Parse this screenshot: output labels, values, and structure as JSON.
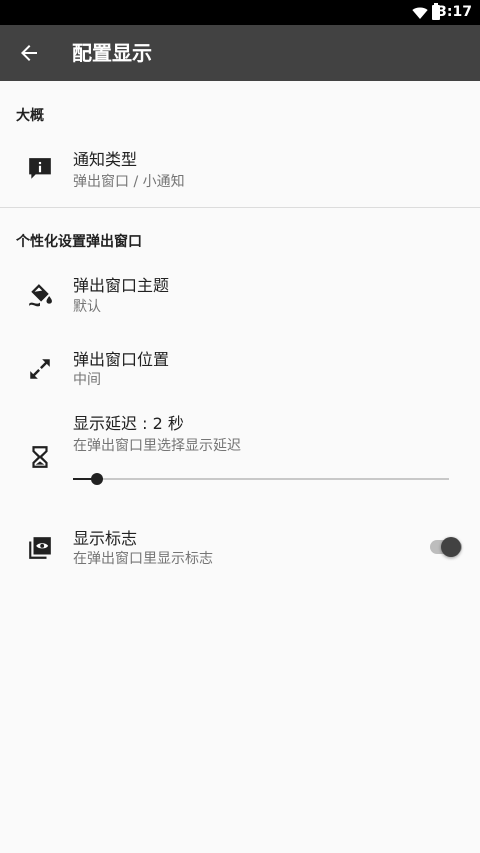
{
  "status_bar": {
    "time": "3:17",
    "icons": [
      "wifi-icon",
      "battery-icon"
    ]
  },
  "app_bar": {
    "title": "配置显示",
    "back_icon": "arrow-back-icon"
  },
  "sections": [
    {
      "header": "大概",
      "items": [
        {
          "icon": "info-icon",
          "title": "通知类型",
          "summary": "弹出窗口 / 小通知"
        }
      ]
    },
    {
      "header": "个性化设置弹出窗口",
      "items": [
        {
          "icon": "paint-bucket-icon",
          "title": "弹出窗口主题",
          "summary": "默认"
        },
        {
          "icon": "resize-arrows-icon",
          "title": "弹出窗口位置",
          "summary": "中间"
        },
        {
          "icon": "hourglass-icon",
          "title": "显示延迟 : 2 秒",
          "summary": "在弹出窗口里选择显示延迟",
          "slider": {
            "value": 2,
            "min": 0,
            "max": 60
          }
        },
        {
          "icon": "badge-eye-icon",
          "title": "显示标志",
          "summary": "在弹出窗口里显示标志",
          "toggle": {
            "on": true
          }
        }
      ]
    }
  ],
  "colors": {
    "app_bar": "#424242",
    "status_bar": "#000000",
    "background": "#fafafa",
    "accent": "#212121"
  }
}
